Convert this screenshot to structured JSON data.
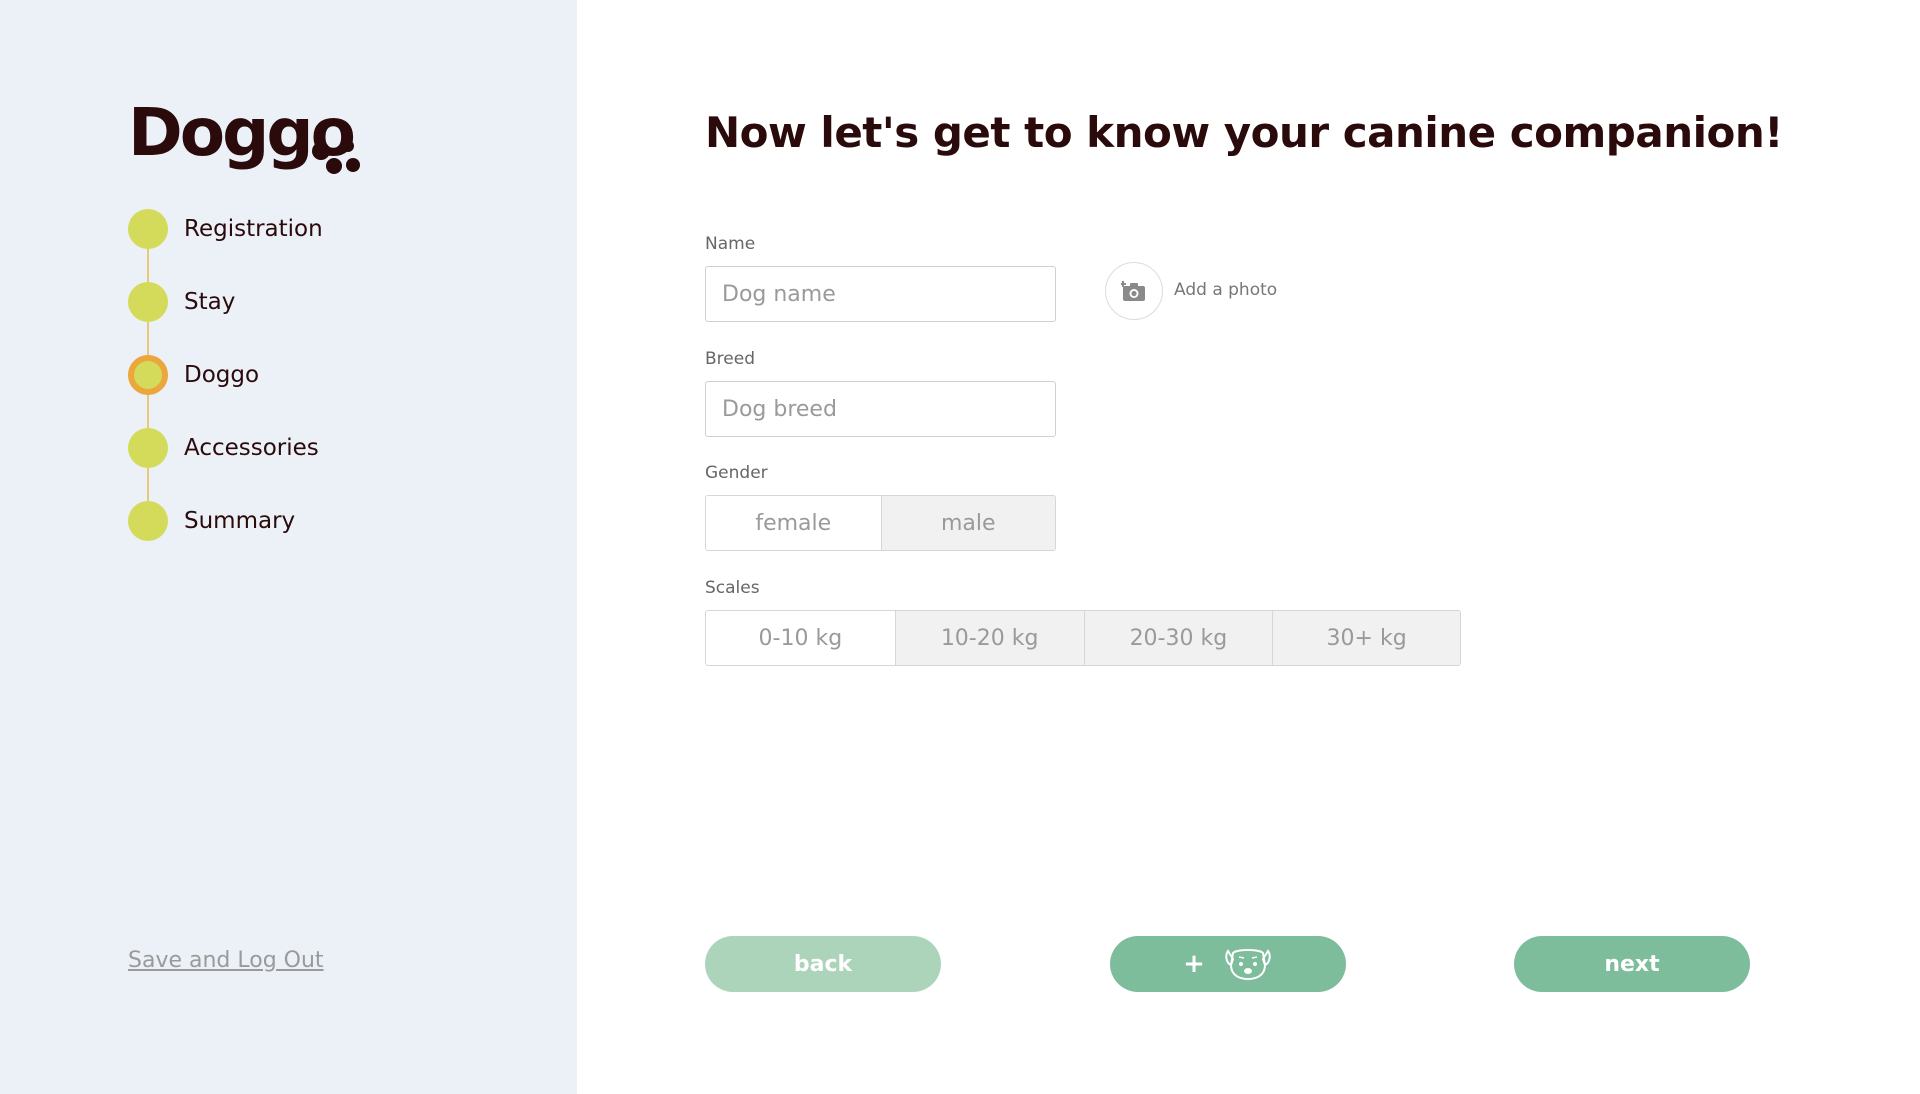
{
  "app": {
    "logo_text": "Doggo"
  },
  "colors": {
    "sidebar_bg": "#ecf1f8",
    "step_dot": "#d4db5a",
    "step_active_ring": "#eba63c",
    "primary_button": "#7dbd9c",
    "back_button": "#acd4ba"
  },
  "sidebar": {
    "steps": [
      {
        "label": "Registration",
        "state": "done"
      },
      {
        "label": "Stay",
        "state": "done"
      },
      {
        "label": "Doggo",
        "state": "current"
      },
      {
        "label": "Accessories",
        "state": "pending"
      },
      {
        "label": "Summary",
        "state": "pending"
      }
    ],
    "logout_label": "Save and Log Out"
  },
  "main": {
    "title": "Now let's get to know your canine companion!",
    "name": {
      "label": "Name",
      "placeholder": "Dog name",
      "value": ""
    },
    "photo": {
      "label": "Add a photo",
      "icon": "camera-add-icon"
    },
    "breed": {
      "label": "Breed",
      "placeholder": "Dog breed",
      "value": ""
    },
    "gender": {
      "label": "Gender",
      "options": [
        "female",
        "male"
      ]
    },
    "scales": {
      "label": "Scales",
      "options": [
        "0-10 kg",
        "10-20 kg",
        "20-30 kg",
        "30+ kg"
      ]
    }
  },
  "footer": {
    "back_label": "back",
    "add_label": "+",
    "add_icon": "dog-face-icon",
    "next_label": "next"
  }
}
